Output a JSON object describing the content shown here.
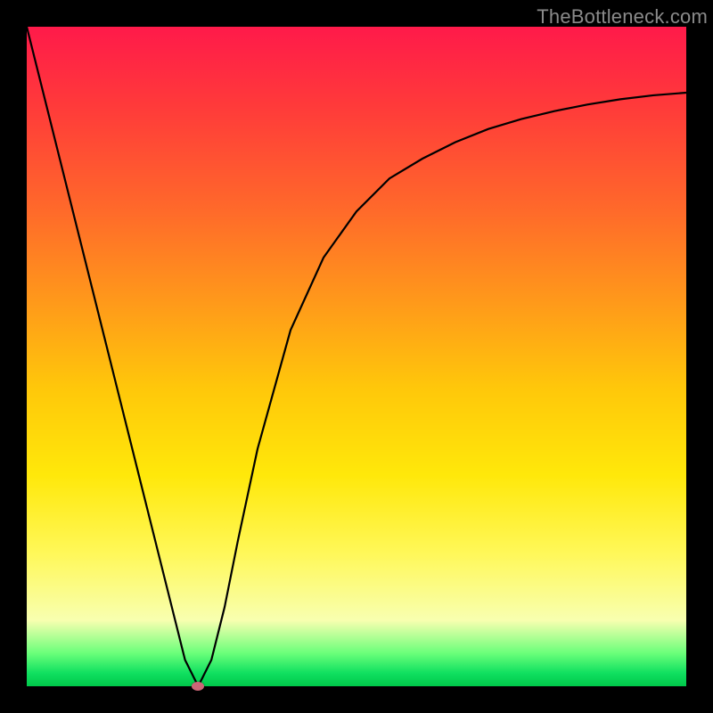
{
  "watermark": "TheBottleneck.com",
  "chart_data": {
    "type": "line",
    "title": "",
    "xlabel": "",
    "ylabel": "",
    "xlim": [
      0,
      100
    ],
    "ylim": [
      0,
      100
    ],
    "grid": false,
    "series": [
      {
        "name": "curve",
        "color": "#000000",
        "x": [
          0,
          5,
          10,
          15,
          20,
          24,
          26,
          28,
          30,
          32,
          35,
          40,
          45,
          50,
          55,
          60,
          65,
          70,
          75,
          80,
          85,
          90,
          95,
          100
        ],
        "y": [
          100,
          80,
          60,
          40,
          20,
          4,
          0,
          4,
          12,
          22,
          36,
          54,
          65,
          72,
          77,
          80,
          82.5,
          84.5,
          86,
          87.2,
          88.2,
          89,
          89.6,
          90
        ]
      }
    ],
    "annotations": [
      {
        "name": "marker",
        "x": 26,
        "y": 0,
        "color": "#cc6677"
      }
    ],
    "background_gradient": {
      "direction": "top-to-bottom",
      "stops": [
        {
          "pos": 0.0,
          "color": "#ff1a4a"
        },
        {
          "pos": 0.12,
          "color": "#ff3a3a"
        },
        {
          "pos": 0.28,
          "color": "#ff6a2a"
        },
        {
          "pos": 0.42,
          "color": "#ff9a1a"
        },
        {
          "pos": 0.55,
          "color": "#ffc80a"
        },
        {
          "pos": 0.68,
          "color": "#ffe80a"
        },
        {
          "pos": 0.8,
          "color": "#fff85a"
        },
        {
          "pos": 0.9,
          "color": "#f8ffb0"
        },
        {
          "pos": 0.95,
          "color": "#6aff7a"
        },
        {
          "pos": 0.98,
          "color": "#10e060"
        },
        {
          "pos": 1.0,
          "color": "#00c84a"
        }
      ]
    }
  }
}
